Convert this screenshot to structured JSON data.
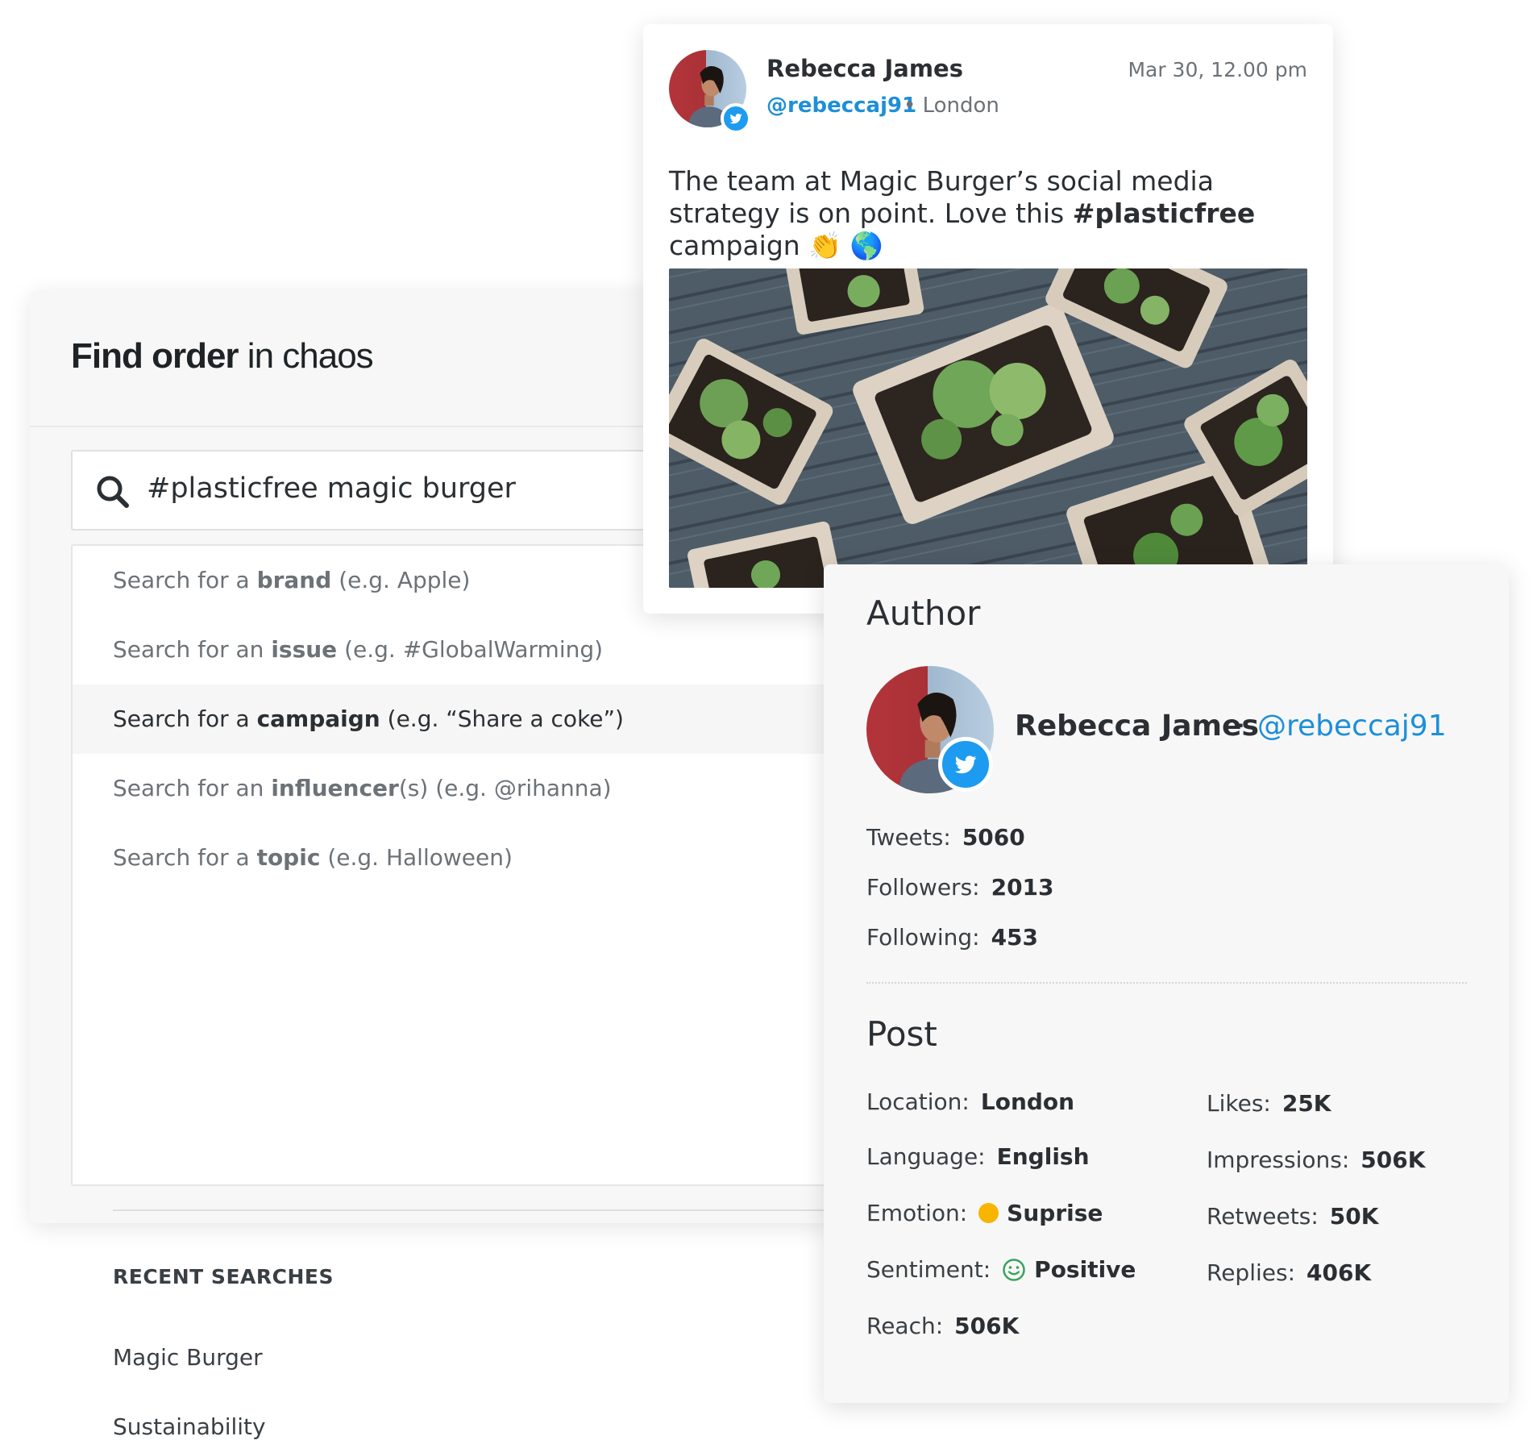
{
  "search": {
    "title_bold": "Find order",
    "title_rest": " in chaos",
    "query": "#plasticfree magic burger",
    "suggestions": [
      {
        "prefix": "Search for a ",
        "keyword": "brand",
        "example": " (e.g. Apple)"
      },
      {
        "prefix": "Search for an ",
        "keyword": "issue",
        "example": " (e.g. #GlobalWarming)"
      },
      {
        "prefix": "Search for a ",
        "keyword": "campaign",
        "example": " (e.g. “Share a coke”)"
      },
      {
        "prefix": "Search for an ",
        "keyword": "influencer",
        "example": "(s) (e.g. @rihanna)"
      },
      {
        "prefix": "Search for a ",
        "keyword": "topic",
        "example": " (e.g. Halloween)"
      }
    ],
    "recent_title": "RECENT SEARCHES",
    "recent": [
      "Magic Burger",
      "Sustainability"
    ]
  },
  "tweet": {
    "name": "Rebecca James",
    "handle": "@rebeccaj91",
    "location": " • London",
    "date": "Mar 30, 12.00 pm",
    "text_before": "The team at Magic Burger’s social media strategy is on point. Love this ",
    "hashtag": "#plasticfree",
    "text_after": " campaign ",
    "emojis": "👏 🌎"
  },
  "author": {
    "section_title": "Author",
    "name": "Rebecca James",
    "separator": "·",
    "handle": "@rebeccaj91",
    "stats": [
      {
        "label": "Tweets:",
        "value": "5060"
      },
      {
        "label": "Followers:",
        "value": "2013"
      },
      {
        "label": "Following:",
        "value": "453"
      }
    ]
  },
  "post": {
    "section_title": "Post",
    "location": {
      "label": "Location:",
      "value": "London"
    },
    "language": {
      "label": "Language:",
      "value": "English"
    },
    "emotion": {
      "label": "Emotion:",
      "value": "Suprise",
      "color": "#f7b500"
    },
    "sentiment": {
      "label": "Sentiment:",
      "value": "Positive",
      "color": "#3aa35b"
    },
    "reach": {
      "label": "Reach:",
      "value": "506K"
    },
    "likes": {
      "label": "Likes:",
      "value": "25K"
    },
    "impressions": {
      "label": "Impressions:",
      "value": "506K"
    },
    "retweets": {
      "label": "Retweets:",
      "value": "50K"
    },
    "replies": {
      "label": "Replies:",
      "value": "406K"
    }
  },
  "colors": {
    "twitter": "#1d9bf0",
    "link": "#1d8fd8"
  }
}
